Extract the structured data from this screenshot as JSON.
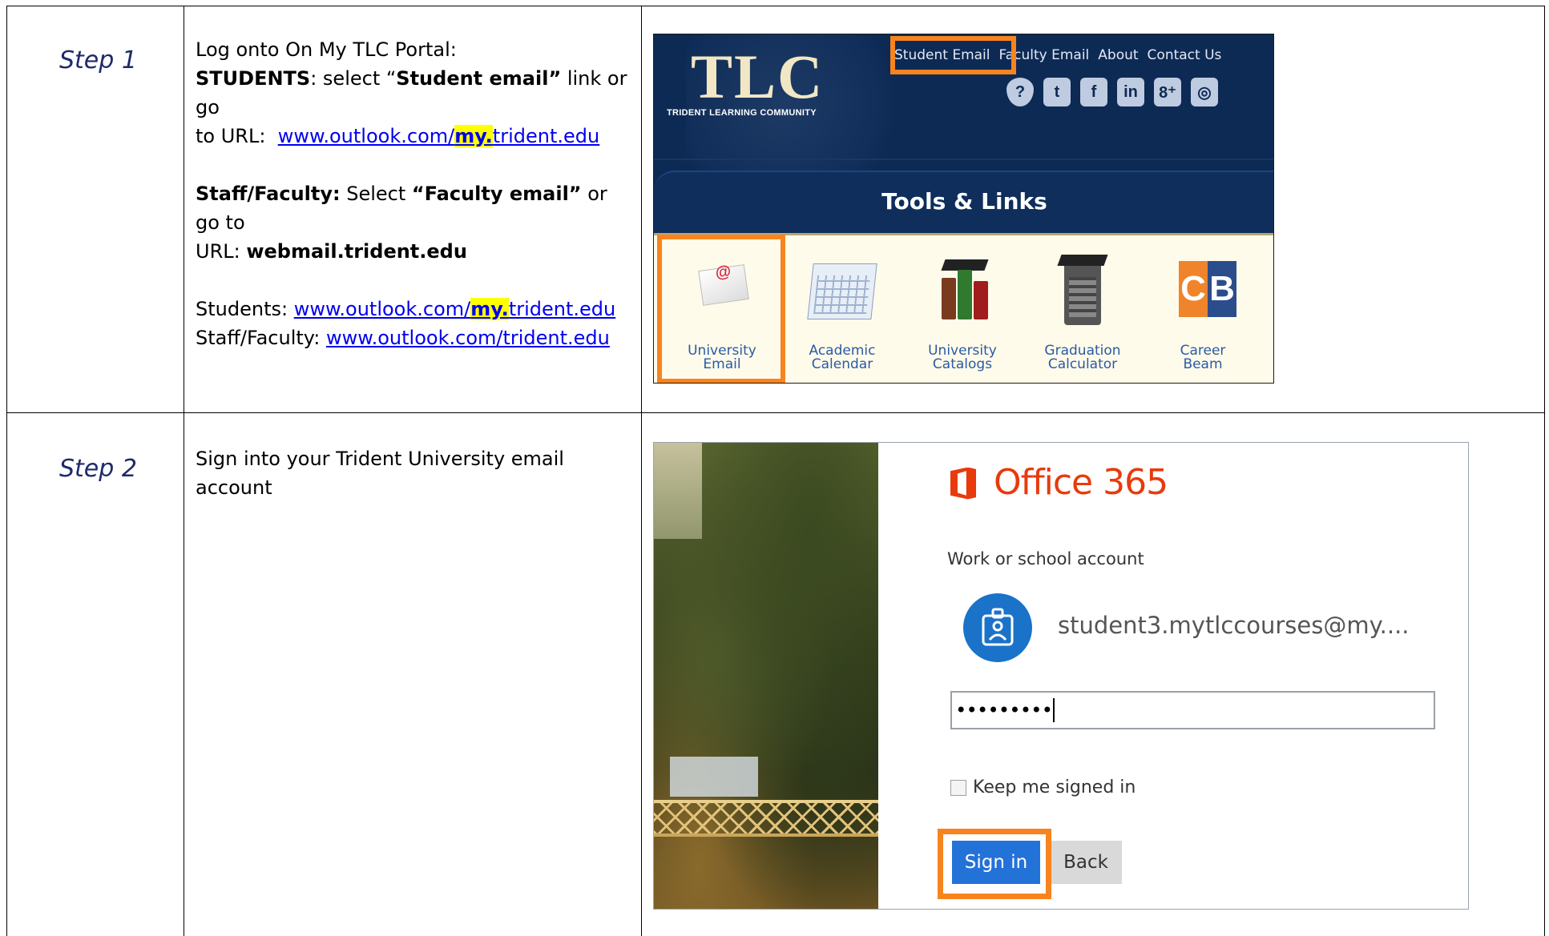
{
  "steps": [
    {
      "label": "Step 1",
      "lines": {
        "l1": "Log onto On My TLC Portal:",
        "students_bold": "STUDENTS",
        "students_mid": ": select “",
        "student_email_bold": "Student email”",
        "students_end": " link or go",
        "to_url": "to URL:",
        "url1_pre": "www.outlook.com/",
        "url1_hl": "my.",
        "url1_post": "trident.edu",
        "staff_bold": "Staff/Faculty:",
        "staff_mid": " Select ",
        "faculty_email_bold": "“Faculty email”",
        "staff_end": " or go to",
        "url_label": "URL: ",
        "webmail_bold": "webmail.trident.edu",
        "students_label": "Students: ",
        "url2_pre": "www.outlook.com/",
        "url2_hl": "my.",
        "url2_post": "trident.edu",
        "staff_label": "Staff/Faculty: ",
        "url3": "www.outlook.com/trident.edu"
      },
      "screenshot": {
        "logo": "TLC",
        "logo_sub": "TRIDENT LEARNING COMMUNITY",
        "nav": [
          "Student Email",
          "Faculty Email",
          "About",
          "Contact Us"
        ],
        "social_icons": [
          "help-shield-icon",
          "twitter-icon",
          "facebook-icon",
          "linkedin-icon",
          "googleplus-icon",
          "instagram-icon"
        ],
        "social_glyphs": [
          "?",
          "t",
          "f",
          "in",
          "8⁺",
          "◎"
        ],
        "section_title": "Tools & Links",
        "tools": [
          {
            "label1": "University",
            "label2": "Email"
          },
          {
            "label1": "Academic",
            "label2": "Calendar"
          },
          {
            "label1": "University",
            "label2": "Catalogs"
          },
          {
            "label1": "Graduation",
            "label2": "Calculator"
          },
          {
            "label1": "Career",
            "label2": "Beam"
          }
        ],
        "cb_letters": [
          "C",
          "B"
        ]
      }
    },
    {
      "label": "Step 2",
      "lines": {
        "l1": "Sign into your Trident University email",
        "l2": "account"
      },
      "screenshot": {
        "brand": "Office 365",
        "account_label": "Work or school account",
        "email": "student3.mytlccourses@my....",
        "password_mask": "•••••••••",
        "keep_signed_in": "Keep me signed in",
        "sign_in": "Sign in",
        "back": "Back"
      }
    }
  ],
  "colors": {
    "highlight": "#ffff00",
    "callout": "#f7841f",
    "tlc_navy": "#0d2a55",
    "office_red": "#e83a0d",
    "signin_blue": "#2372d8"
  }
}
